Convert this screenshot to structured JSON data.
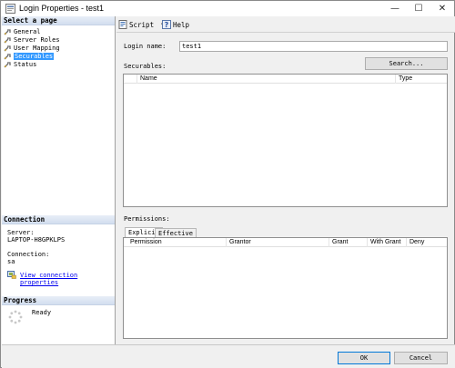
{
  "window": {
    "title": "Login Properties - test1",
    "controls": {
      "minimize": "—",
      "maximize": "☐",
      "close": "✕"
    }
  },
  "left": {
    "select_page_header": "Select a page",
    "pages": [
      {
        "label": "General",
        "selected": false
      },
      {
        "label": "Server Roles",
        "selected": false
      },
      {
        "label": "User Mapping",
        "selected": false
      },
      {
        "label": "Securables",
        "selected": true
      },
      {
        "label": "Status",
        "selected": false
      }
    ],
    "connection_header": "Connection",
    "server_label": "Server:",
    "server_value": "LAPTOP-H8GPKLPS",
    "connection_label": "Connection:",
    "connection_value": "sa",
    "view_link": "View connection properties",
    "progress_header": "Progress",
    "progress_status": "Ready"
  },
  "toolbar": {
    "script_label": "Script",
    "help_label": "Help"
  },
  "main": {
    "login_name_label": "Login name:",
    "login_name_value": "test1",
    "securables_label": "Securables:",
    "search_button": "Search...",
    "securables_columns": [
      "Name",
      "Type"
    ],
    "permissions_label": "Permissions:",
    "tabs": [
      "Explicit",
      "Effective"
    ],
    "permissions_columns": [
      "Permission",
      "Grantor",
      "Grant",
      "With Grant",
      "Deny"
    ]
  },
  "footer": {
    "ok": "OK",
    "cancel": "Cancel"
  }
}
